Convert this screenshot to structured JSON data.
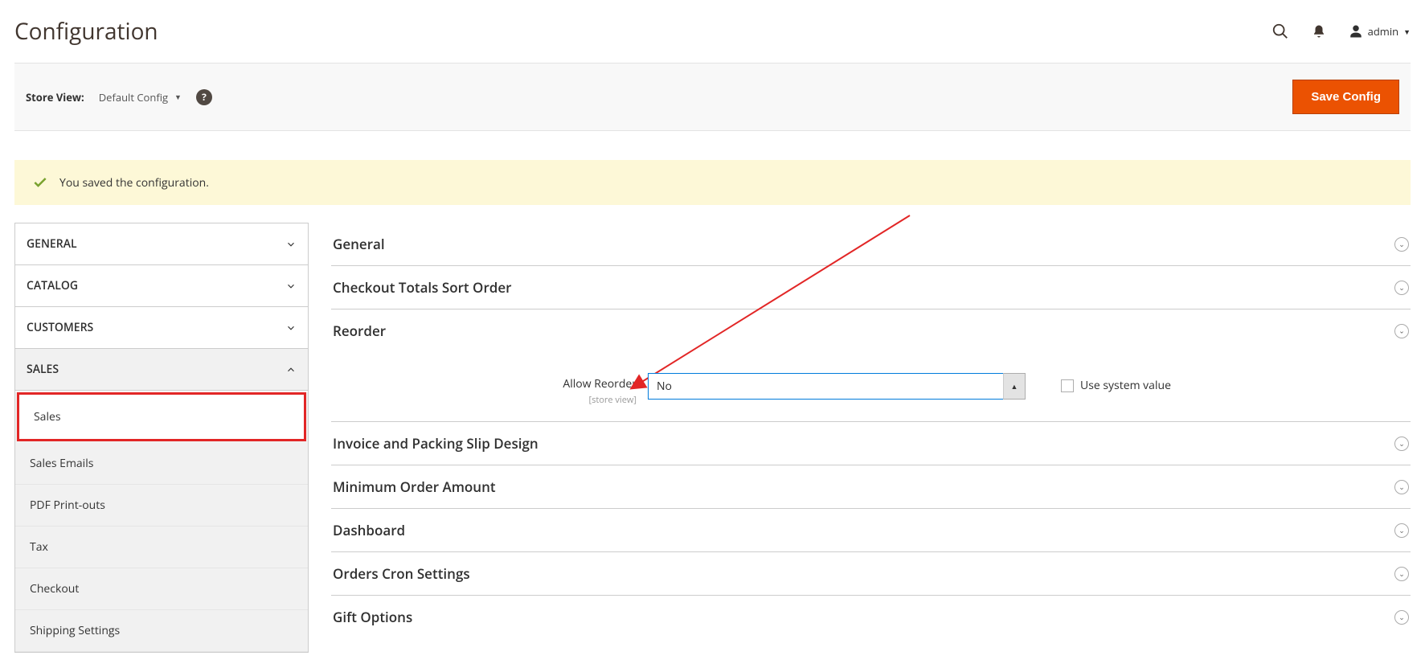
{
  "header": {
    "title": "Configuration",
    "user_label": "admin"
  },
  "toolbar": {
    "store_view_label": "Store View:",
    "store_view_value": "Default Config",
    "save_label": "Save Config"
  },
  "message": "You saved the configuration.",
  "sidebar": {
    "groups": [
      {
        "label": "GENERAL",
        "expanded": false
      },
      {
        "label": "CATALOG",
        "expanded": false
      },
      {
        "label": "CUSTOMERS",
        "expanded": false
      },
      {
        "label": "SALES",
        "expanded": true
      }
    ],
    "items": [
      {
        "label": "Sales",
        "active": true
      },
      {
        "label": "Sales Emails"
      },
      {
        "label": "PDF Print-outs"
      },
      {
        "label": "Tax"
      },
      {
        "label": "Checkout"
      },
      {
        "label": "Shipping Settings"
      }
    ]
  },
  "sections": [
    {
      "title": "General"
    },
    {
      "title": "Checkout Totals Sort Order"
    },
    {
      "title": "Reorder",
      "open": true
    },
    {
      "title": "Invoice and Packing Slip Design"
    },
    {
      "title": "Minimum Order Amount"
    },
    {
      "title": "Dashboard"
    },
    {
      "title": "Orders Cron Settings"
    },
    {
      "title": "Gift Options"
    }
  ],
  "reorder_field": {
    "label": "Allow Reorder",
    "scope": "[store view]",
    "value": "No",
    "use_system": "Use system value"
  }
}
